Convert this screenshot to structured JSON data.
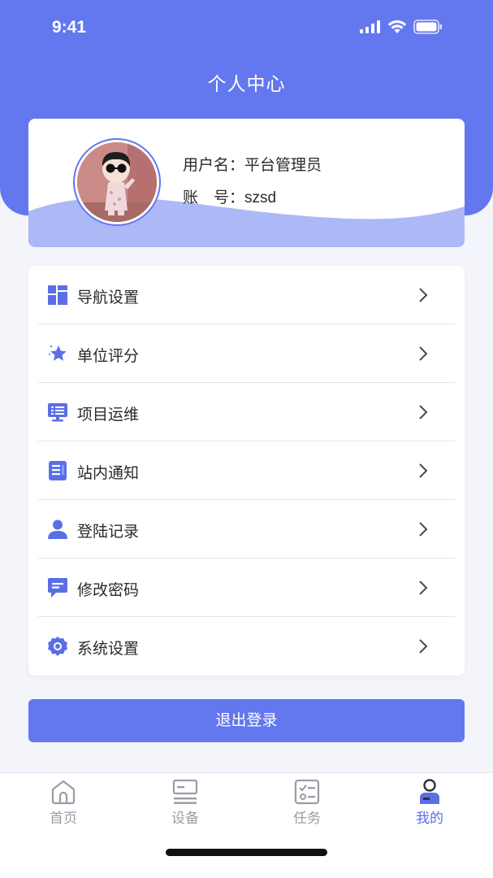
{
  "status_bar": {
    "time": "9:41"
  },
  "header": {
    "title": "个人中心"
  },
  "profile": {
    "username_label": "用户名：",
    "username": "平台管理员",
    "account_label": "账　号：",
    "account": "szsd"
  },
  "menu": {
    "items": [
      {
        "label": "导航设置",
        "icon": "grid-layout-icon"
      },
      {
        "label": "单位评分",
        "icon": "star-rating-icon"
      },
      {
        "label": "项目运维",
        "icon": "monitor-icon"
      },
      {
        "label": "站内通知",
        "icon": "document-list-icon"
      },
      {
        "label": "登陆记录",
        "icon": "user-icon"
      },
      {
        "label": "修改密码",
        "icon": "chat-bubble-icon"
      },
      {
        "label": "系统设置",
        "icon": "gear-icon"
      }
    ]
  },
  "logout": {
    "label": "退出登录"
  },
  "tabbar": {
    "items": [
      {
        "label": "首页",
        "icon": "home-icon",
        "active": false
      },
      {
        "label": "设备",
        "icon": "device-icon",
        "active": false
      },
      {
        "label": "任务",
        "icon": "task-icon",
        "active": false
      },
      {
        "label": "我的",
        "icon": "profile-icon",
        "active": true
      }
    ]
  },
  "colors": {
    "primary": "#6377ef",
    "wave": "#adb8f7",
    "icon": "#5a6fe6",
    "tab_inactive": "#9a9da6"
  }
}
